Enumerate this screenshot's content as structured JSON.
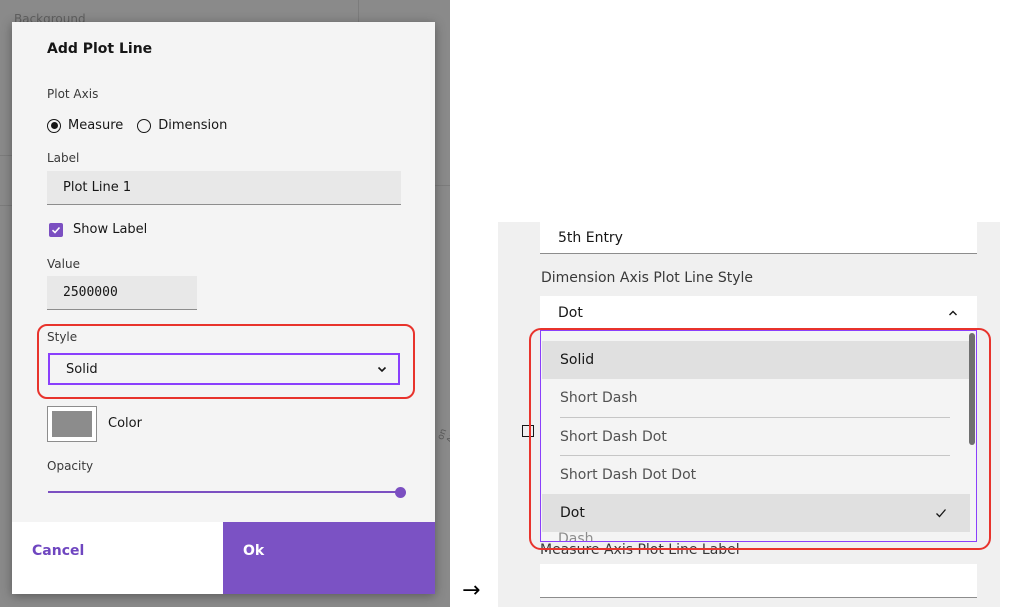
{
  "background": {
    "app_text": "Background",
    "side_text": "on Ax"
  },
  "dialog": {
    "title": "Add Plot Line",
    "plot_axis": {
      "label": "Plot Axis",
      "options": [
        "Measure",
        "Dimension"
      ],
      "selected": "Measure"
    },
    "label_field": {
      "label": "Label",
      "value": "Plot Line 1"
    },
    "show_label": {
      "label": "Show Label",
      "checked": true
    },
    "value_field": {
      "label": "Value",
      "value": "2500000"
    },
    "style_field": {
      "label": "Style",
      "value": "Solid"
    },
    "color": {
      "label": "Color",
      "swatch": "#8c8c8c"
    },
    "opacity": {
      "label": "Opacity",
      "level": 1.0
    },
    "buttons": {
      "cancel": "Cancel",
      "ok": "Ok"
    }
  },
  "arrow": "→",
  "right_panel": {
    "top_input_value": "5th Entry",
    "dim_style_label": "Dimension Axis Plot Line Style",
    "dim_style_value": "Dot",
    "options": [
      "Solid",
      "Short Dash",
      "Short Dash Dot",
      "Short Dash Dot Dot",
      "Dot",
      "Dash"
    ],
    "selected_option": "Dot",
    "measure_label": "Measure Axis Plot Line Label"
  },
  "colors": {
    "accent": "#7b52c4",
    "focus": "#8a3ffc",
    "highlight": "#e8332c"
  },
  "icons": {
    "dialog_select": "chevron-down-icon",
    "right_select": "chevron-up-icon",
    "selected_mark": "checkmark-icon",
    "checkbox": "checkmark-icon"
  }
}
